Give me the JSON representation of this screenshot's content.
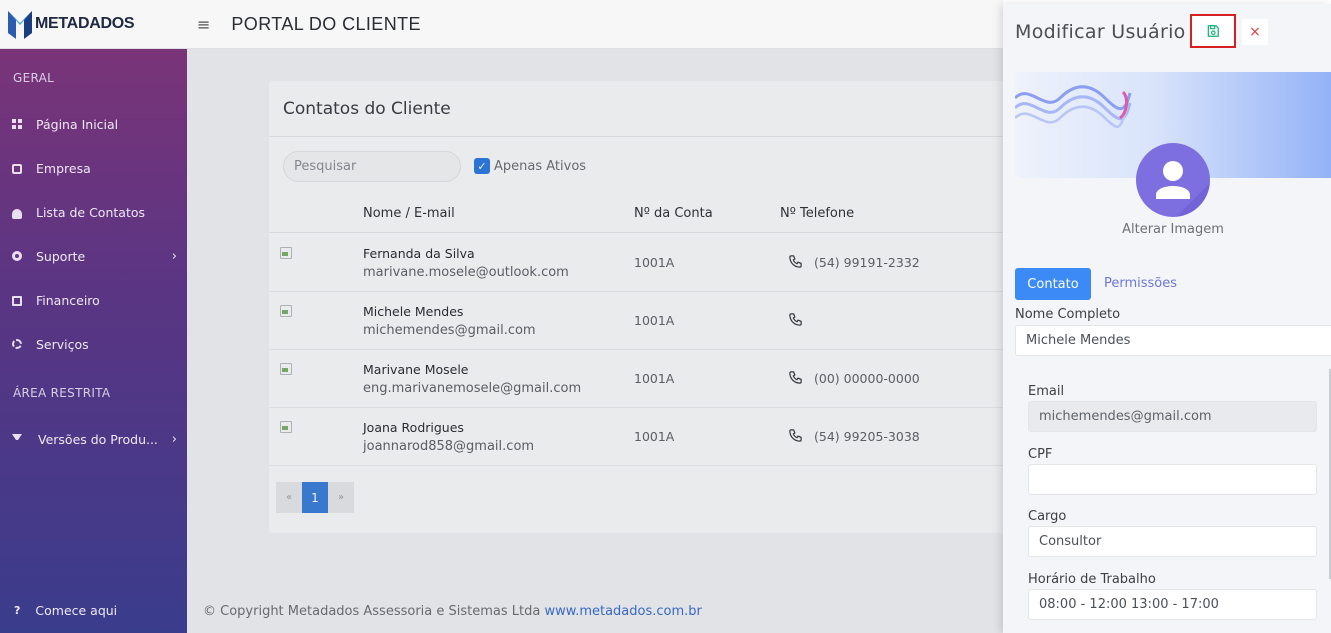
{
  "brand": {
    "name": "METADADOS"
  },
  "header": {
    "menu_icon": "menu-icon",
    "title": "PORTAL DO CLIENTE"
  },
  "sidebar": {
    "section_general": "GERAL",
    "items": [
      {
        "label": "Página Inicial",
        "icon": "grid-icon"
      },
      {
        "label": "Empresa",
        "icon": "briefcase-icon"
      },
      {
        "label": "Lista de Contatos",
        "icon": "users-icon"
      },
      {
        "label": "Suporte",
        "icon": "support-icon"
      },
      {
        "label": "Financeiro",
        "icon": "money-icon"
      },
      {
        "label": "Serviços",
        "icon": "gear-icon"
      }
    ],
    "section_restricted": "ÁREA RESTRITA",
    "restricted_items": [
      {
        "label": "Versões do Produ...",
        "icon": "download-icon"
      }
    ],
    "help": {
      "icon": "question-icon",
      "label": "Comece aqui"
    }
  },
  "contacts": {
    "title": "Contatos do Cliente",
    "search_placeholder": "Pesquisar",
    "only_active_label": "Apenas Ativos",
    "only_active_checked": true,
    "columns": [
      "Nome / E-mail",
      "Nº da Conta",
      "Nº Telefone"
    ],
    "rows": [
      {
        "name": "Fernanda da Silva",
        "email": "marivane.mosele@outlook.com",
        "account": "1001A",
        "phone": "(54) 99191-2332"
      },
      {
        "name": "Michele Mendes",
        "email": "michemendes@gmail.com",
        "account": "1001A",
        "phone": ""
      },
      {
        "name": "Marivane Mosele",
        "email": "eng.marivanemosele@gmail.com",
        "account": "1001A",
        "phone": "(00) 00000-0000"
      },
      {
        "name": "Joana Rodrigues",
        "email": "joannarod858@gmail.com",
        "account": "1001A",
        "phone": "(54) 99205-3038"
      }
    ],
    "pagination": {
      "prev": "«",
      "current": "1",
      "next": "»"
    }
  },
  "footer": {
    "copyright": "© Copyright Metadados Assessoria e Sistemas Ltda",
    "link": "www.metadados.com.br"
  },
  "panel": {
    "title": "Modificar Usuário",
    "save_icon": "save-icon",
    "close_symbol": "×",
    "change_image": "Alterar Imagem",
    "tabs": {
      "contact": "Contato",
      "permissions": "Permissões"
    },
    "fields": {
      "full_name_label": "Nome Completo",
      "full_name": "Michele Mendes",
      "email_label": "Email",
      "email": "michemendes@gmail.com",
      "cpf_label": "CPF",
      "cpf": "",
      "role_label": "Cargo",
      "role": "Consultor",
      "hours_label": "Horário de Trabalho",
      "hours": "08:00 - 12:00 13:00 - 17:00"
    }
  },
  "colors": {
    "primary": "#3b8af5",
    "pager_active": "#3b7fd9",
    "save_highlight": "#d92020",
    "close": "#e03a3a",
    "save_icon": "#19b37a",
    "sidebar_top": "#7a3478",
    "sidebar_bottom": "#3a3c8c"
  }
}
